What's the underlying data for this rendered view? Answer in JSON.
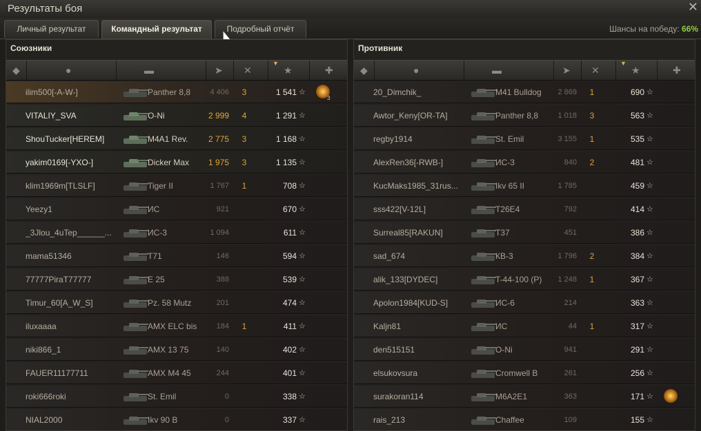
{
  "window": {
    "title": "Результаты боя",
    "close_icon": "close-icon"
  },
  "tabs": [
    {
      "label": "Личный результат",
      "active": false
    },
    {
      "label": "Командный результат",
      "active": true
    },
    {
      "label": "Подробный отчёт",
      "active": false
    }
  ],
  "win_chance": {
    "label": "Шансы на победу:",
    "value": "66%"
  },
  "colors": {
    "accent_green": "#8fce3e",
    "damage_player": "#e0a53a",
    "kills": "#d9a341"
  },
  "columns": {
    "icons": [
      "tier-icon",
      "player-icon",
      "tank-icon",
      "damage-icon",
      "kills-icon",
      "xp-star-icon",
      "medal-icon"
    ],
    "sorted_by": "xp"
  },
  "allies": {
    "title": "Союзники",
    "rows": [
      {
        "name": "ilim500[-A-W-]",
        "vehicle": "Panther 8,8",
        "damage": "4 406",
        "kills": "3",
        "xp": "1 541",
        "highlight": "me",
        "medal": true,
        "medal_count": "3"
      },
      {
        "name": "VITALIY_SVA",
        "vehicle": "O-Ni",
        "damage": "2 999",
        "kills": "4",
        "xp": "1 291",
        "highlight": "platoon"
      },
      {
        "name": "ShouTucker[HEREM]",
        "vehicle": "M4A1 Rev.",
        "damage": "2 775",
        "kills": "3",
        "xp": "1 168",
        "highlight": "platoon"
      },
      {
        "name": "yakim0169[-YXO-]",
        "vehicle": "Dicker Max",
        "damage": "1 975",
        "kills": "3",
        "xp": "1 135",
        "highlight": "platoon"
      },
      {
        "name": "klim1969m[TLSLF]",
        "vehicle": "Tiger II",
        "damage": "1 767",
        "kills": "1",
        "xp": "708"
      },
      {
        "name": "Yeezy1",
        "vehicle": "ИС",
        "damage": "921",
        "kills": "",
        "xp": "670"
      },
      {
        "name": "_3Jlou_4uTep______...",
        "vehicle": "ИС-3",
        "damage": "1 094",
        "kills": "",
        "xp": "611"
      },
      {
        "name": "mama51346",
        "vehicle": "T71",
        "damage": "146",
        "kills": "",
        "xp": "594"
      },
      {
        "name": "77777PiraT77777",
        "vehicle": "E 25",
        "damage": "388",
        "kills": "",
        "xp": "539"
      },
      {
        "name": "Timur_60[A_W_S]",
        "vehicle": "Pz. 58 Mutz",
        "damage": "201",
        "kills": "",
        "xp": "474"
      },
      {
        "name": "iluxaaaa",
        "vehicle": "AMX ELC bis",
        "damage": "184",
        "kills": "1",
        "xp": "411"
      },
      {
        "name": "niki866_1",
        "vehicle": "AMX 13 75",
        "damage": "140",
        "kills": "",
        "xp": "402"
      },
      {
        "name": "FAUER11177711",
        "vehicle": "AMX M4 45",
        "damage": "244",
        "kills": "",
        "xp": "401"
      },
      {
        "name": "roki666roki",
        "vehicle": "St. Emil",
        "damage": "0",
        "kills": "",
        "xp": "338"
      },
      {
        "name": "NIAL2000",
        "vehicle": "Ikv 90 B",
        "damage": "0",
        "kills": "",
        "xp": "337"
      }
    ]
  },
  "enemies": {
    "title": "Противник",
    "rows": [
      {
        "name": "20_Dimchik_",
        "vehicle": "M41 Bulldog",
        "damage": "2 869",
        "kills": "1",
        "xp": "690"
      },
      {
        "name": "Awtor_Keny[OR-TA]",
        "vehicle": "Panther 8,8",
        "damage": "1 018",
        "kills": "3",
        "xp": "563"
      },
      {
        "name": "regby1914",
        "vehicle": "St. Emil",
        "damage": "3 155",
        "kills": "1",
        "xp": "535"
      },
      {
        "name": "AlexRen36[-RWB-]",
        "vehicle": "ИС-3",
        "damage": "840",
        "kills": "2",
        "xp": "481"
      },
      {
        "name": "KucMaks1985_31rus...",
        "vehicle": "Ikv 65 II",
        "damage": "1 785",
        "kills": "",
        "xp": "459"
      },
      {
        "name": "sss422[V-12L]",
        "vehicle": "T26E4",
        "damage": "792",
        "kills": "",
        "xp": "414"
      },
      {
        "name": "Surreal85[RAKUN]",
        "vehicle": "T37",
        "damage": "451",
        "kills": "",
        "xp": "386"
      },
      {
        "name": "sad_674",
        "vehicle": "КВ-3",
        "damage": "1 796",
        "kills": "2",
        "xp": "384"
      },
      {
        "name": "alik_133[DYDEC]",
        "vehicle": "T-44-100 (P)",
        "damage": "1 248",
        "kills": "1",
        "xp": "367"
      },
      {
        "name": "Apolon1984[KUD-S]",
        "vehicle": "ИС-6",
        "damage": "214",
        "kills": "",
        "xp": "363"
      },
      {
        "name": "Kaljn81",
        "vehicle": "ИС",
        "damage": "44",
        "kills": "1",
        "xp": "317"
      },
      {
        "name": "den515151",
        "vehicle": "O-Ni",
        "damage": "941",
        "kills": "",
        "xp": "291"
      },
      {
        "name": "elsukovsura",
        "vehicle": "Cromwell B",
        "damage": "261",
        "kills": "",
        "xp": "256"
      },
      {
        "name": "surakoran114",
        "vehicle": "M6A2E1",
        "damage": "363",
        "kills": "",
        "xp": "171",
        "medal": true
      },
      {
        "name": "rais_213",
        "vehicle": "Chaffee",
        "damage": "109",
        "kills": "",
        "xp": "155"
      }
    ]
  }
}
